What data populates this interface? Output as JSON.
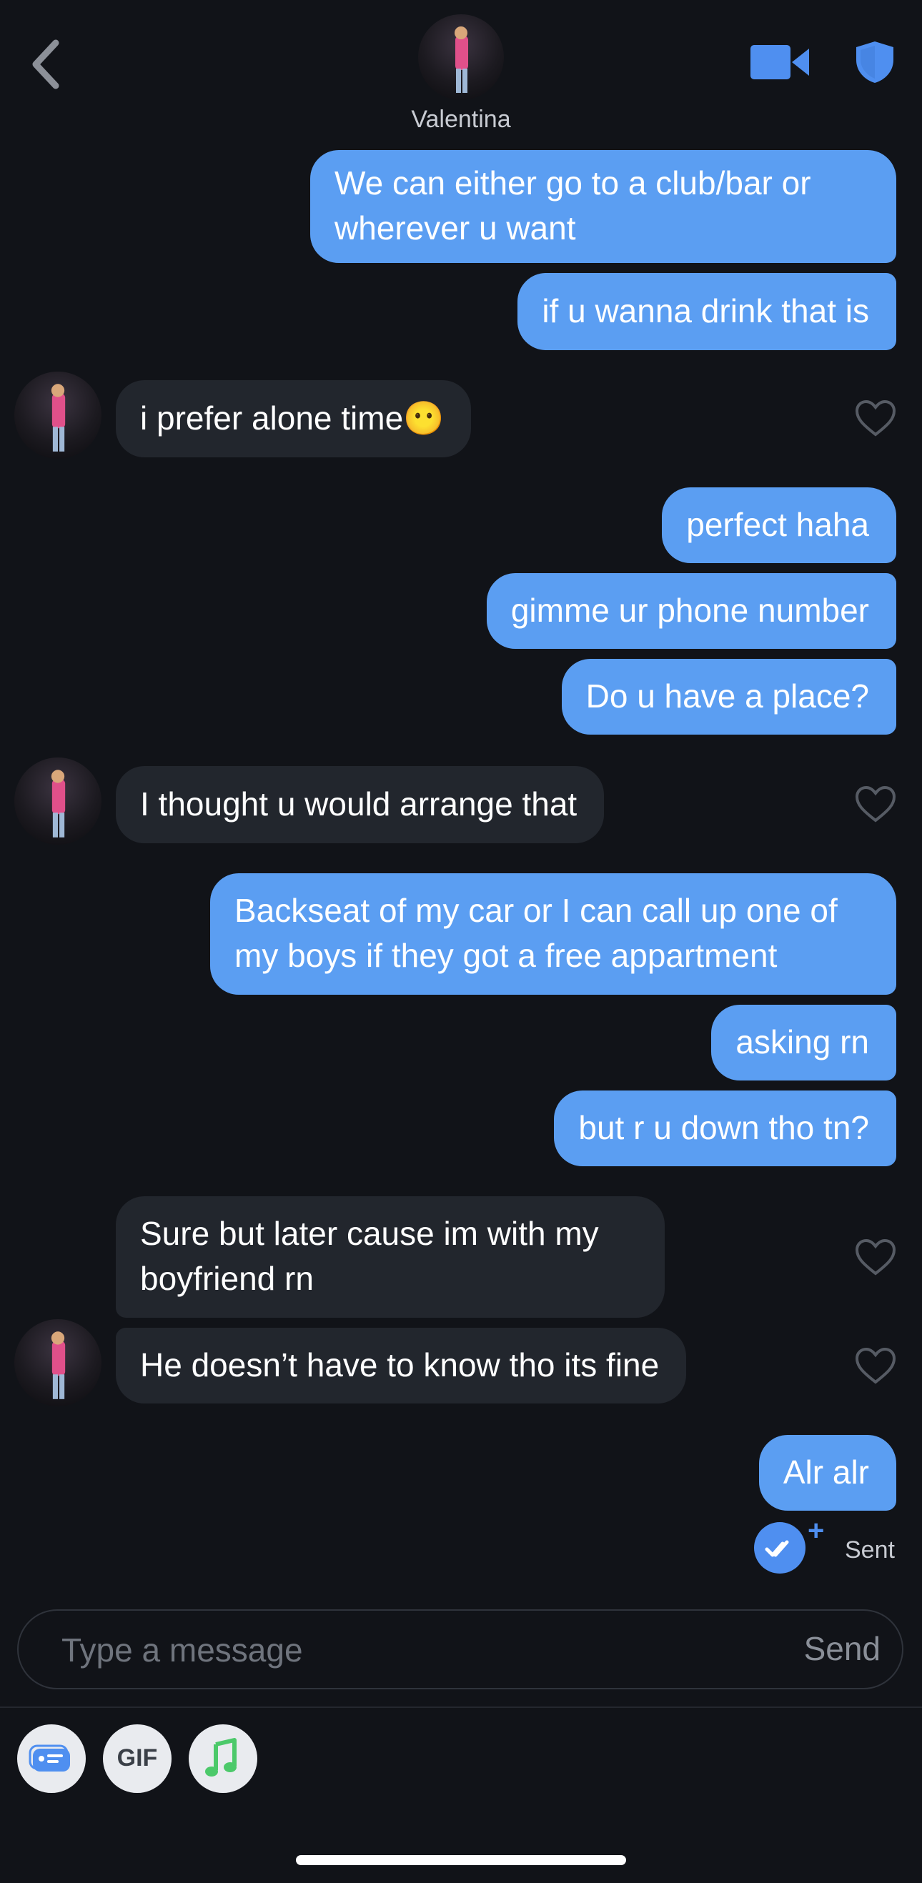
{
  "header": {
    "contact_name": "Valentina",
    "back_icon": "chevron-left-icon",
    "video_icon": "video-camera-icon",
    "shield_icon": "shield-icon",
    "accent": "#4f8ff0"
  },
  "messages": [
    {
      "dir": "out",
      "text": "We can either go to a club/bar or wherever u want"
    },
    {
      "dir": "out",
      "text": "if u wanna drink that is"
    },
    {
      "dir": "in",
      "text": "i prefer alone time",
      "emoji": "😶"
    },
    {
      "dir": "out",
      "text": "perfect haha"
    },
    {
      "dir": "out",
      "text": "gimme ur phone number"
    },
    {
      "dir": "out",
      "text": "Do u have a place?"
    },
    {
      "dir": "in",
      "text": "I thought u would arrange that"
    },
    {
      "dir": "out",
      "text": "Backseat of my car or I can call up one of my boys if they got a free appartment"
    },
    {
      "dir": "out",
      "text": "asking rn"
    },
    {
      "dir": "out",
      "text": "but r u down tho tn?"
    },
    {
      "dir": "in",
      "text": "Sure but later cause im with my boyfriend rn"
    },
    {
      "dir": "in",
      "text": "He doesn’t have to know tho its fine"
    },
    {
      "dir": "out",
      "text": "Alr alr"
    }
  ],
  "status": {
    "sent_label": "Sent",
    "plus": "+"
  },
  "composer": {
    "placeholder": "Type a message",
    "send_label": "Send"
  },
  "toolbar": {
    "gif_label": "GIF",
    "card_icon": "message-card-icon",
    "music_icon": "music-note-icon"
  },
  "colors": {
    "background": "#111318",
    "outgoing_bubble": "#5b9ef2",
    "incoming_bubble": "#22262d"
  }
}
